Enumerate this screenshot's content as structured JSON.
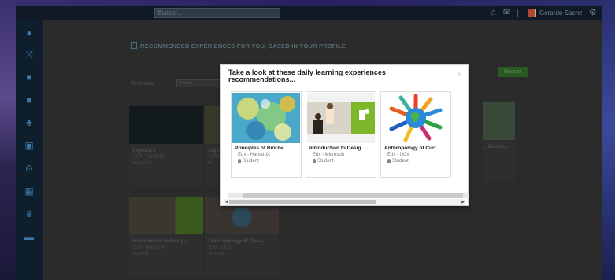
{
  "topbar": {
    "search_placeholder": "Buscar...",
    "home_icon": "home-icon",
    "mail_icon": "mail-icon",
    "user_name": "Gerardo Saenz",
    "settings_icon": "gear-icon"
  },
  "sidebar": {
    "items": [
      {
        "icon": "user-icon",
        "glyph": "👤"
      },
      {
        "icon": "shuffle-icon",
        "glyph": "⇄"
      },
      {
        "icon": "briefcase-icon",
        "glyph": "▣"
      },
      {
        "icon": "briefcase-icon-2",
        "glyph": "▣"
      },
      {
        "icon": "groups-icon",
        "glyph": "♣"
      },
      {
        "icon": "calendar-icon",
        "glyph": "▦"
      },
      {
        "icon": "check-circle-icon",
        "glyph": "⊙"
      },
      {
        "icon": "calendar-grid-icon",
        "glyph": "▤"
      },
      {
        "icon": "trophy-icon",
        "glyph": "🏆"
      },
      {
        "icon": "inbox-icon",
        "glyph": "▭"
      }
    ]
  },
  "main": {
    "section_title": "RECOMMENDED EXPERIENCES FOR YOU, BASED IN YOUR PROFILE",
    "filter_label": "Recursos",
    "filter_value": "Select",
    "action_button": "Buscar",
    "background_cards": [
      {
        "title": "Algebra 1",
        "subtitle": "UTN-Tac DMS",
        "role": "Instructor"
      },
      {
        "title": "Algeb...",
        "subtitle": "UTN",
        "role": "In..."
      },
      {
        "title": "...Bioche...",
        "subtitle": "",
        "role": ""
      },
      {
        "title": "Introduction to Desig...",
        "subtitle": "Edx - Microsoft",
        "role": "Student"
      },
      {
        "title": "Anthropology of Curr...",
        "subtitle": "Edx - UGx",
        "role": "Student"
      }
    ]
  },
  "modal": {
    "title": "Take a look at these daily learning experiences recommendations...",
    "close_label": "×",
    "cards": [
      {
        "title": "Principles of Bioche...",
        "provider": "Edx - HarvardX",
        "role": "Student"
      },
      {
        "title": "Introduction to Desig...",
        "provider": "Edx - Microsoft",
        "role": "Student"
      },
      {
        "title": "Anthropology of Curr...",
        "provider": "Edx - UGx",
        "role": "Student"
      }
    ]
  },
  "colors": {
    "sidebar_icon": "#3d78a8",
    "modal_bg": "#ffffff",
    "accent_green": "#2a5a22"
  }
}
